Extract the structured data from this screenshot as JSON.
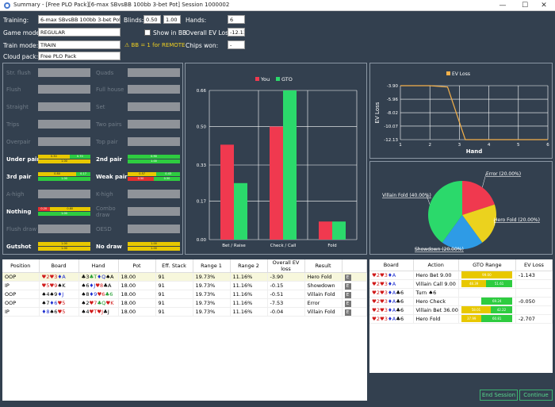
{
  "window": {
    "title": "Summary - [Free PLO Pack][6-max SBvsBB 100bb 3-bet Pot] Session 1000002",
    "minimize": "—",
    "maximize": "☐",
    "close": "✕"
  },
  "header": {
    "training_label": "Training:",
    "training_value": "6-max SBvsBB 100bb 3-bet Pot",
    "blinds_label": "Blinds:",
    "blind_sb": "0.50",
    "blind_bb": "1.00",
    "hands_label": "Hands:",
    "hands_value": "6",
    "game_mode_label": "Game mode:",
    "game_mode_value": "REGULAR",
    "show_in_bb_label": "Show in BB",
    "overall_ev_label": "Overall EV Loss:",
    "overall_ev_value": "-12.13",
    "train_mode_label": "Train mode:",
    "train_mode_value": "TRAIN",
    "warning_text": "⚠ BB = 1 for REMOTE",
    "chips_won_label": "Chips won:",
    "chips_won_value": "-",
    "cloud_pack_label": "Cloud pack:",
    "cloud_pack_value": "Free PLO Pack"
  },
  "hand_categories": {
    "left": [
      {
        "label": "Str. flush",
        "active": false
      },
      {
        "label": "Flush",
        "active": false
      },
      {
        "label": "Straight",
        "active": false
      },
      {
        "label": "Trips",
        "active": false
      },
      {
        "label": "Overpair",
        "active": false
      },
      {
        "label": "Under pair",
        "active": true,
        "rows": [
          [
            [
              "#e8c800",
              0.6,
              "0.30"
            ],
            [
              "#2ecc40",
              0.4,
              "0.70"
            ]
          ],
          [
            [
              "#e8c800",
              1.0,
              "1.00"
            ]
          ]
        ]
      },
      {
        "label": "3rd pair",
        "active": true,
        "rows": [
          [
            [
              "#e8c800",
              0.73,
              "0.80"
            ],
            [
              "#2ecc40",
              0.27,
              "0.17"
            ]
          ],
          [
            [
              "#2ecc40",
              1.0,
              "1.00"
            ]
          ]
        ]
      },
      {
        "label": "A-high",
        "active": false
      },
      {
        "label": "Nothing",
        "active": true,
        "rows": [
          [
            [
              "#e53030",
              0.22,
              "0.20"
            ],
            [
              "#e8c800",
              0.78,
              "0.80"
            ]
          ],
          [
            [
              "#2ecc40",
              1.0,
              "1.00"
            ]
          ]
        ]
      },
      {
        "label": "Flush draw",
        "active": false
      },
      {
        "label": "Gutshot",
        "active": true,
        "rows": [
          [
            [
              "#e8c800",
              1.0,
              "1.00"
            ]
          ],
          [
            [
              "#e8c800",
              1.0,
              "1.00"
            ]
          ]
        ]
      }
    ],
    "right": [
      {
        "label": "Quads",
        "active": false
      },
      {
        "label": "Full house",
        "active": false
      },
      {
        "label": "Set",
        "active": false
      },
      {
        "label": "Two pairs",
        "active": false
      },
      {
        "label": "Top pair",
        "active": false
      },
      {
        "label": "2nd pair",
        "active": true,
        "rows": [
          [
            [
              "#2ecc40",
              1.0,
              "0.90"
            ]
          ],
          [
            [
              "#2ecc40",
              1.0,
              "1.00"
            ]
          ]
        ]
      },
      {
        "label": "Weak pair",
        "active": true,
        "rows": [
          [
            [
              "#e8c800",
              0.55,
              "0.57"
            ],
            [
              "#2ecc40",
              0.45,
              "0.43"
            ]
          ],
          [
            [
              "#e53030",
              0.5,
              "0.50"
            ],
            [
              "#2ecc40",
              0.5,
              "0.50"
            ]
          ]
        ]
      },
      {
        "label": "K-high",
        "active": false
      },
      {
        "label": "Combo draw",
        "active": false
      },
      {
        "label": "OESD",
        "active": false
      },
      {
        "label": "No draw",
        "active": true,
        "rows": [
          [
            [
              "#e8c800",
              1.0,
              "1.00"
            ]
          ],
          [
            [
              "#e8c800",
              1.0,
              "1.00"
            ]
          ]
        ]
      }
    ]
  },
  "chart_data": [
    {
      "type": "bar",
      "categories": [
        "Bet / Raise",
        "Check / Call",
        "Fold"
      ],
      "series": [
        {
          "name": "You",
          "color": "#f0394f",
          "values": [
            0.42,
            0.5,
            0.08
          ]
        },
        {
          "name": "GTO",
          "color": "#2bd96b",
          "values": [
            0.25,
            0.66,
            0.08
          ]
        }
      ],
      "ylim": [
        0,
        0.66
      ],
      "yticks": [
        "0.00",
        "0.17",
        "0.33",
        "0.50",
        "0.66"
      ],
      "grid": true,
      "legend": "top"
    },
    {
      "type": "line",
      "title": "",
      "series": [
        {
          "name": "EV Loss",
          "color": "#f5b14a",
          "x": [
            1,
            2,
            2.6,
            3.2,
            4,
            5,
            6
          ],
          "y": [
            -3.9,
            -3.9,
            -4.1,
            -12.13,
            -12.13,
            -12.13,
            -12.13
          ]
        }
      ],
      "xlabel": "Hand",
      "ylabel": "EV Loss",
      "xticks": [
        "1",
        "2",
        "3",
        "4",
        "5",
        "6"
      ],
      "yticks": [
        "-3.90",
        "-5.96",
        "-8.02",
        "-10.07",
        "-12.13"
      ],
      "xlim": [
        1,
        6
      ],
      "ylim": [
        -12.13,
        -3.9
      ],
      "legend": "top"
    },
    {
      "type": "pie",
      "categories": [
        "Error (20.00%)",
        "Hero Fold (20.00%)",
        "Showdown (20.00%)",
        "Villain Fold (40.00%)"
      ],
      "values": [
        20,
        20,
        20,
        40
      ],
      "colors": [
        "#f0394f",
        "#ebd21e",
        "#2e9be6",
        "#2bd96b"
      ]
    }
  ],
  "hands_table": {
    "columns": [
      "Position",
      "Board",
      "Hand",
      "Pot",
      "Eff. Stack",
      "Range 1",
      "Range 2",
      "Overall EV loss",
      "Result",
      ""
    ],
    "rows": [
      {
        "position": "OOP",
        "board": [
          [
            "r",
            "♥2"
          ],
          [
            "r",
            "♥3"
          ],
          [
            "b",
            "♦A"
          ]
        ],
        "hand": [
          [
            "k",
            "♣3"
          ],
          [
            "g",
            "♣T"
          ],
          [
            "b",
            "♦Q"
          ],
          [
            "k",
            "♠A"
          ]
        ],
        "pot": "18.00",
        "stack": "91",
        "r1": "19.73%",
        "r2": "11.16%",
        "ev": "-3.90",
        "result": "Hero Fold",
        "e": "E"
      },
      {
        "position": "IP",
        "board": [
          [
            "r",
            "♥5"
          ],
          [
            "r",
            "♥9"
          ],
          [
            "k",
            "♠K"
          ]
        ],
        "hand": [
          [
            "k",
            "♠6"
          ],
          [
            "b",
            "♦J"
          ],
          [
            "r",
            "♥8"
          ],
          [
            "k",
            "♣A"
          ]
        ],
        "pot": "18.00",
        "stack": "91",
        "r1": "19.73%",
        "r2": "11.16%",
        "ev": "-0.15",
        "result": "Showdown",
        "e": "E"
      },
      {
        "position": "OOP",
        "board": [
          [
            "k",
            "♠4"
          ],
          [
            "k",
            "♠9"
          ],
          [
            "b",
            "♦J"
          ]
        ],
        "hand": [
          [
            "k",
            "♠8"
          ],
          [
            "b",
            "♦9"
          ],
          [
            "r",
            "♥6"
          ],
          [
            "g",
            "♣6"
          ]
        ],
        "pot": "18.00",
        "stack": "91",
        "r1": "19.73%",
        "r2": "11.16%",
        "ev": "-0.51",
        "result": "Villain Fold",
        "e": "E"
      },
      {
        "position": "OOP",
        "board": [
          [
            "k",
            "♠7"
          ],
          [
            "b",
            "♦6"
          ],
          [
            "r",
            "♥5"
          ]
        ],
        "hand": [
          [
            "k",
            "♠2"
          ],
          [
            "r",
            "♥7"
          ],
          [
            "g",
            "♣Q"
          ],
          [
            "r",
            "♥K"
          ]
        ],
        "pot": "18.00",
        "stack": "91",
        "r1": "19.73%",
        "r2": "11.16%",
        "ev": "-7.53",
        "result": "Error",
        "e": "E"
      },
      {
        "position": "IP",
        "board": [
          [
            "b",
            "♦8"
          ],
          [
            "k",
            "♠6"
          ],
          [
            "r",
            "♥5"
          ]
        ],
        "hand": [
          [
            "k",
            "♠4"
          ],
          [
            "r",
            "♥T"
          ],
          [
            "r",
            "♥J"
          ],
          [
            "k",
            "♣J"
          ]
        ],
        "pot": "18.00",
        "stack": "91",
        "r1": "19.73%",
        "r2": "11.16%",
        "ev": "-0.04",
        "result": "Villain Fold",
        "e": "E"
      }
    ]
  },
  "actions_table": {
    "columns": [
      "Board",
      "Action",
      "GTO Range",
      "EV Loss"
    ],
    "rows": [
      {
        "board": [
          [
            "r",
            "♥2"
          ],
          [
            "r",
            "♥3"
          ],
          [
            "b",
            "♦A"
          ]
        ],
        "action": "Hero Bet 9.00",
        "bars": [
          [
            "#e8c800",
            1.0,
            "99.00"
          ]
        ],
        "ev": "-1.143"
      },
      {
        "board": [
          [
            "r",
            "♥2"
          ],
          [
            "r",
            "♥3"
          ],
          [
            "b",
            "♦A"
          ]
        ],
        "action": "Villain Call 9.00",
        "bars": [
          [
            "#e8c800",
            0.49,
            "48.39"
          ],
          [
            "#2ecc40",
            0.51,
            "51.61"
          ]
        ],
        "ev": ""
      },
      {
        "board": [
          [
            "r",
            "♥2"
          ],
          [
            "r",
            "♥3"
          ],
          [
            "b",
            "♦A"
          ],
          [
            "k",
            "♣6"
          ]
        ],
        "action": "Turn ♠6",
        "bars": [],
        "ev": ""
      },
      {
        "board": [
          [
            "r",
            "♥2"
          ],
          [
            "r",
            "♥3"
          ],
          [
            "b",
            "♦A"
          ],
          [
            "k",
            "♣6"
          ]
        ],
        "action": "Hero Check",
        "bars": [
          [
            "#ffffff",
            0.4,
            ""
          ],
          [
            "#2ecc40",
            0.6,
            "69.24"
          ]
        ],
        "ev": "-0.050"
      },
      {
        "board": [
          [
            "r",
            "♥2"
          ],
          [
            "r",
            "♥3"
          ],
          [
            "b",
            "♦A"
          ],
          [
            "k",
            "♣6"
          ]
        ],
        "action": "Villain Bet 36.00",
        "bars": [
          [
            "#e8c800",
            0.58,
            "58.01"
          ],
          [
            "#2ecc40",
            0.42,
            "42.22"
          ]
        ],
        "ev": ""
      },
      {
        "board": [
          [
            "r",
            "♥2"
          ],
          [
            "r",
            "♥3"
          ],
          [
            "b",
            "♦A"
          ],
          [
            "k",
            "♣6"
          ]
        ],
        "action": "Hero Fold",
        "bars": [
          [
            "#e8c800",
            0.4,
            "37.99"
          ],
          [
            "#2ecc40",
            0.6,
            "60.81"
          ]
        ],
        "ev": "-2.707"
      }
    ]
  },
  "buttons": {
    "end_session": "End Session",
    "continue": "Continue"
  }
}
